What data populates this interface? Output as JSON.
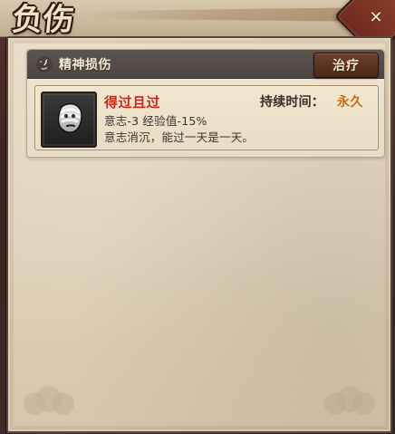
{
  "window": {
    "title": "负伤"
  },
  "injury_panel": {
    "section_title": "精神损伤",
    "treat_button_label": "治疗",
    "injury": {
      "name": "得过且过",
      "duration_label": "持续时间：",
      "duration_value": "永久",
      "effects_line": "意志-3  经验值-15%",
      "description": "意志消沉，能过一天是一天。"
    }
  },
  "icons": {
    "close": "close-icon",
    "section": "mental-injury-icon",
    "avatar": "bandaged-face-icon"
  },
  "colors": {
    "accent_red": "#c12a14",
    "accent_orange": "#c96a12",
    "card_header_bg": "#5b5450",
    "treat_button_bg": "#6d3f2b"
  }
}
